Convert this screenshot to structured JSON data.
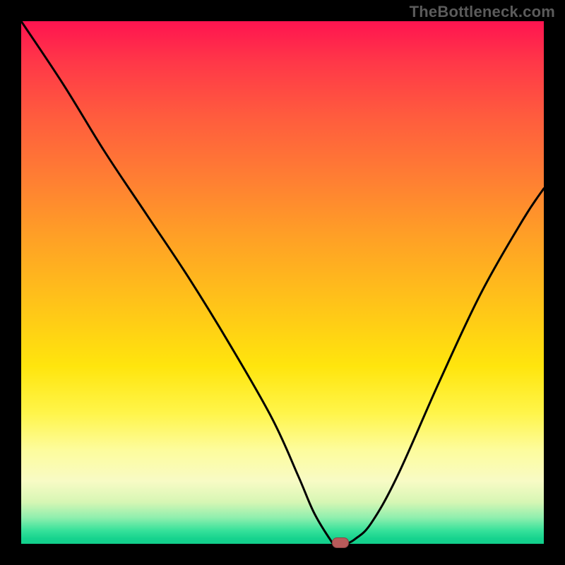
{
  "watermark": "TheBottleneck.com",
  "chart_data": {
    "type": "line",
    "title": "",
    "xlabel": "",
    "ylabel": "",
    "xlim": [
      0,
      100
    ],
    "ylim": [
      0,
      100
    ],
    "series": [
      {
        "name": "curve",
        "x": [
          0,
          8,
          16,
          24,
          32,
          40,
          48,
          53,
          56,
          59,
          60,
          62,
          64,
          67,
          72,
          80,
          88,
          96,
          100
        ],
        "values": [
          100,
          88,
          75,
          63,
          51,
          38,
          24,
          13,
          6,
          1,
          0,
          0,
          1,
          4,
          13,
          31,
          48,
          62,
          68
        ]
      }
    ],
    "marker": {
      "x": 61,
      "y": 0
    },
    "background_gradient": {
      "colors": [
        "#ff1450",
        "#ffa225",
        "#ffe50d",
        "#f8fbc5",
        "#16d38e"
      ],
      "positions": [
        0,
        42,
        66,
        88,
        99
      ]
    }
  }
}
